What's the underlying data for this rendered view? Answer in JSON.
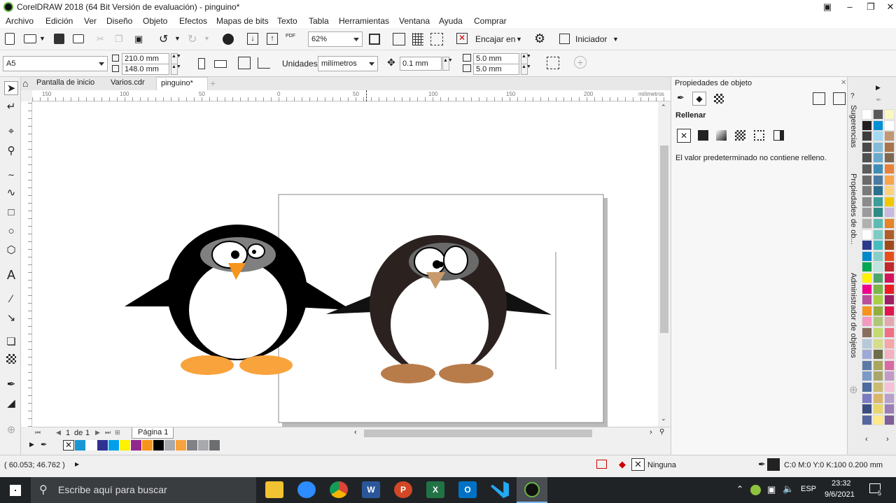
{
  "window": {
    "title": "CorelDRAW 2018 (64 Bit Versión de evaluación) - pinguino*"
  },
  "menu": [
    "Archivo",
    "Edición",
    "Ver",
    "Diseño",
    "Objeto",
    "Efectos",
    "Mapas de bits",
    "Texto",
    "Tabla",
    "Herramientas",
    "Ventana",
    "Ayuda",
    "Comprar"
  ],
  "toolbar1": {
    "zoom": "62%",
    "fit_label": "Encajar en",
    "start_label": "Iniciador",
    "pdf_label": "PDF"
  },
  "toolbar2": {
    "page_size": "A5",
    "width": "210.0 mm",
    "height": "148.0 mm",
    "units_label": "Unidades:",
    "units_value": "milímetros",
    "nudge": "0.1 mm",
    "dup_x": "5.0 mm",
    "dup_y": "5.0 mm"
  },
  "tabs": [
    "Pantalla de inicio",
    "Varios.cdr",
    "pinguino*"
  ],
  "ruler": {
    "ticks": [
      "150",
      "100",
      "50",
      "0",
      "50",
      "100",
      "150",
      "200"
    ],
    "unit": "milímetros"
  },
  "pagebar": {
    "page_index": "1",
    "of_label": "de",
    "page_count": "1",
    "page_tab": "Página 1"
  },
  "docker": {
    "title": "Propiedades de objeto",
    "section": "Rellenar",
    "message": "El valor predeterminado no contiene relleno."
  },
  "docker_tabs": [
    "Sugerencias",
    "Propiedades de ob...",
    "Administrador de objetos"
  ],
  "status": {
    "coords": "( 60.053; 46.762 )",
    "fill_label": "Ninguna",
    "outline_label": "C:0 M:0 Y:0 K:100  0.200 mm"
  },
  "taskbar": {
    "search_placeholder": "Escribe aquí para buscar",
    "lang": "ESP",
    "time": "23:32",
    "date": "9/6/2021",
    "notifications": "5",
    "apps": [
      "W",
      "P",
      "X",
      "O"
    ]
  },
  "palette_bottom": [
    "#1a96d4",
    "#ffffff",
    "#2e3192",
    "#00a0e9",
    "#fff200",
    "#92278f",
    "#f7941d",
    "#000000",
    "#a7a9ac",
    "#f9a33d",
    "#808285",
    "#a7a9ac",
    "#6d6e71"
  ],
  "palette_right": [
    "#ffffff",
    "#58595b",
    "#fbf7c0",
    "#231f20",
    "#0090d5",
    "#ffffff",
    "#3d3d3d",
    "#a3d9f3",
    "#c29774",
    "#4a4a4a",
    "#83bbd9",
    "#a8744b",
    "#505050",
    "#6aa9c9",
    "#7e6852",
    "#5c5c5c",
    "#3f8db7",
    "#e8823a",
    "#6a6a6a",
    "#4a7aa2",
    "#f7a54a",
    "#7a7a7a",
    "#2c6f8f",
    "#fdd27f",
    "#8b8b8b",
    "#3b9e9b",
    "#f2c700",
    "#9a9a9a",
    "#2e8b85",
    "#c9b8e0",
    "#b0b0b0",
    "#5dbbb4",
    "#e58429",
    "#ffffff",
    "#7ccbc5",
    "#b15d2b",
    "#2b3a8f",
    "#46bcc0",
    "#a04a1c",
    "#0088cc",
    "#86cfc9",
    "#e84e1b",
    "#00a651",
    "#bfe3df",
    "#c1272d",
    "#fff200",
    "#4fa46a",
    "#d4145a",
    "#ec008c",
    "#7ab648",
    "#ed1c24",
    "#b94e9b",
    "#a8cf45",
    "#9e1f63",
    "#f7941d",
    "#93ae3f",
    "#e3154f",
    "#f49ac1",
    "#afc877",
    "#e4a7b0",
    "#8a6e5d",
    "#c2da6f",
    "#f16e84",
    "#b5c9d9",
    "#d5de8a",
    "#f6a5a8",
    "#9fa9d8",
    "#6d6e49",
    "#f5b0c1",
    "#5b7ba6",
    "#a9a660",
    "#d96ba3",
    "#7b9ac7",
    "#a8a66d",
    "#c39ac6",
    "#4c6b9e",
    "#c9bb72",
    "#f7c0d8",
    "#7b7bc2",
    "#dbb569",
    "#b8a0cc",
    "#3a4d80",
    "#e8d66a",
    "#9b7fb5",
    "#56659e",
    "#ffe98a",
    "#7d5e96"
  ],
  "colors": {
    "accent": "#1e88e5",
    "penguin1_feet": "#f9a33d",
    "penguin2_feet": "#b87c4b",
    "penguin2_body": "#2b2220"
  }
}
